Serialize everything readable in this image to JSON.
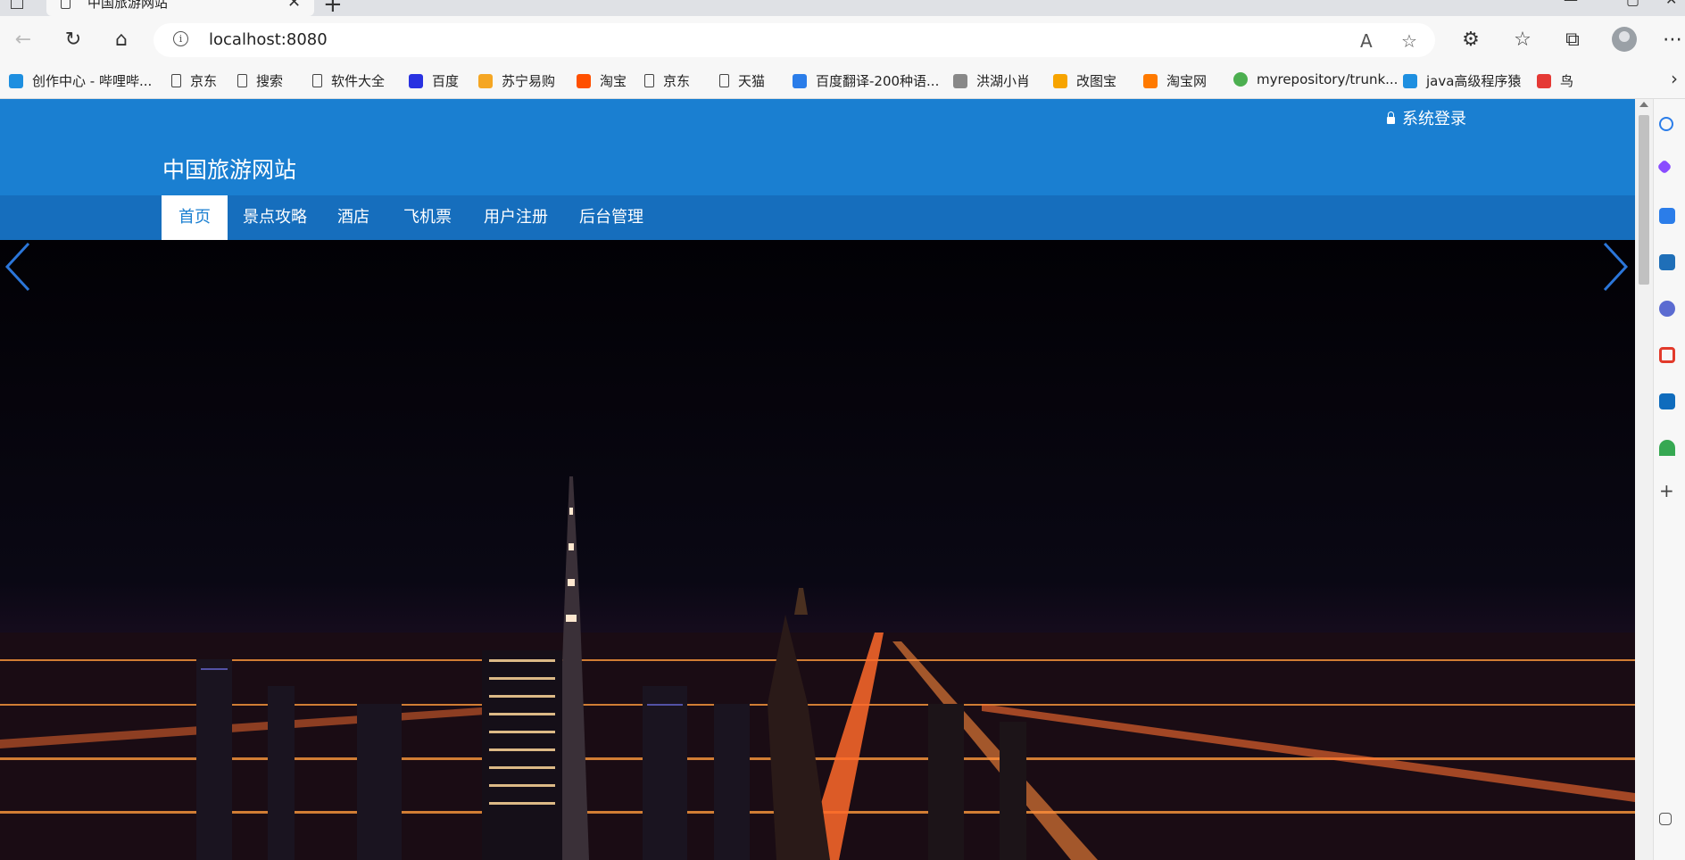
{
  "browser": {
    "tab_title": "中国旅游网站",
    "url": "localhost:8080",
    "bookmarks": [
      {
        "label": "创作中心 - 哔哩哔...",
        "icon": "bilibili-icon",
        "color": "#1e8fe0"
      },
      {
        "label": "京东",
        "icon": "page-icon",
        "color": ""
      },
      {
        "label": "搜索",
        "icon": "page-icon",
        "color": ""
      },
      {
        "label": "软件大全",
        "icon": "page-icon",
        "color": ""
      },
      {
        "label": "百度",
        "icon": "baidu-paw-icon",
        "color": "#2932e1"
      },
      {
        "label": "苏宁易购",
        "icon": "suning-icon",
        "color": "#f5a623"
      },
      {
        "label": "淘宝",
        "icon": "taobao-icon",
        "color": "#ff5000"
      },
      {
        "label": "京东",
        "icon": "page-icon",
        "color": ""
      },
      {
        "label": "天猫",
        "icon": "page-icon",
        "color": ""
      },
      {
        "label": "百度翻译-200种语...",
        "icon": "translate-icon",
        "color": "#2b7de9"
      },
      {
        "label": "洪湖小肖",
        "icon": "bird-icon",
        "color": "#888888"
      },
      {
        "label": "改图宝",
        "icon": "gaitubao-icon",
        "color": "#f7a400"
      },
      {
        "label": "淘宝网",
        "icon": "taobao-icon",
        "color": "#ff7a00"
      },
      {
        "label": "myrepository/trunk...",
        "icon": "chrome-icon",
        "color": "#4caf50"
      },
      {
        "label": "java高级程序猿",
        "icon": "bilibili-icon",
        "color": "#1e8fe0"
      },
      {
        "label": "鸟",
        "icon": "bird-red-icon",
        "color": "#e53935"
      }
    ]
  },
  "site": {
    "login_label": "系统登录",
    "title": "中国旅游网站",
    "nav": [
      "首页",
      "景点攻略",
      "酒店",
      "飞机票",
      "用户注册",
      "后台管理"
    ],
    "header_color": "#1a7fd1",
    "nav_color": "#166ebd"
  }
}
